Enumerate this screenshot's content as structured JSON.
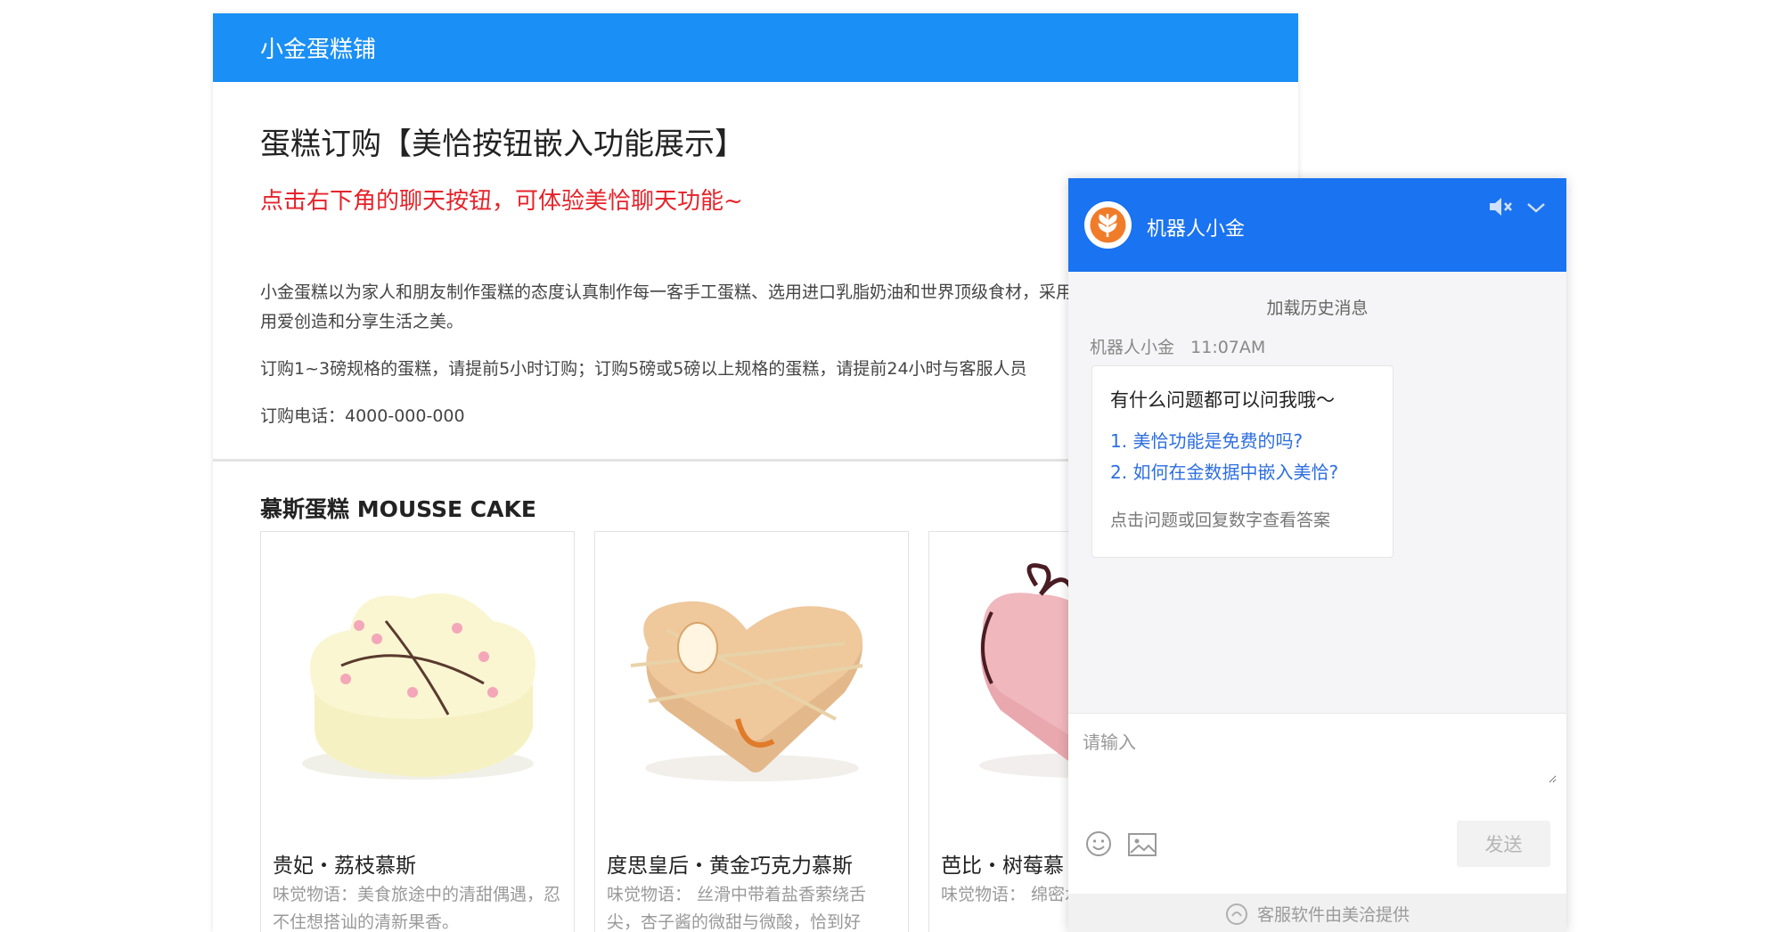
{
  "shop": {
    "name": "小金蛋糕铺"
  },
  "intro": {
    "title": "蛋糕订购【美恰按钮嵌入功能展示】",
    "hint": "点击右下角的聊天按钮，可体验美恰聊天功能~",
    "paragraph1": "小金蛋糕以为家人和朋友制作蛋糕的态度认真制作每一客手工蛋糕、选用进口乳脂奶油和世界顶级食材，采用绿色环保的包装，用心用爱创造和分享生活之美。",
    "paragraph2": "订购1~3磅规格的蛋糕，请提前5小时订购；订购5磅或5磅以上规格的蛋糕，请提前24小时与客服人员",
    "phone": "订购电话：4000-000-000"
  },
  "section": {
    "title": "慕斯蛋糕 MOUSSE CAKE"
  },
  "cakes": [
    {
      "name": "贵妃・荔枝慕斯",
      "desc": "味觉物语：美食旅途中的清甜偶遇，忍不住想搭讪的清新果香。"
    },
    {
      "name": "度思皇后・黄金巧克力慕斯",
      "desc": "味觉物语： 丝滑中带着盐香萦绕舌尖，杏子酱的微甜与微酸，恰到好"
    },
    {
      "name": "芭比・树莓慕",
      "desc": "味觉物语： 绵密水果的颗粒口感"
    }
  ],
  "chat": {
    "bot_name": "机器人小金",
    "load_history": "加载历史消息",
    "sender": "机器人小金",
    "time": "11:07AM",
    "greeting": "有什么问题都可以问我哦～",
    "questions": [
      "1. 美恰功能是免费的吗?",
      "2. 如何在金数据中嵌入美恰?"
    ],
    "tip": "点击问题或回复数字查看答案",
    "input_placeholder": "请输入",
    "send_label": "发送",
    "footer": "客服软件由美洽提供",
    "accent": "#1a73f0"
  },
  "colors": {
    "topbar": "#1a8ff5",
    "hint": "#e6232a",
    "link": "#2d6ee0"
  }
}
